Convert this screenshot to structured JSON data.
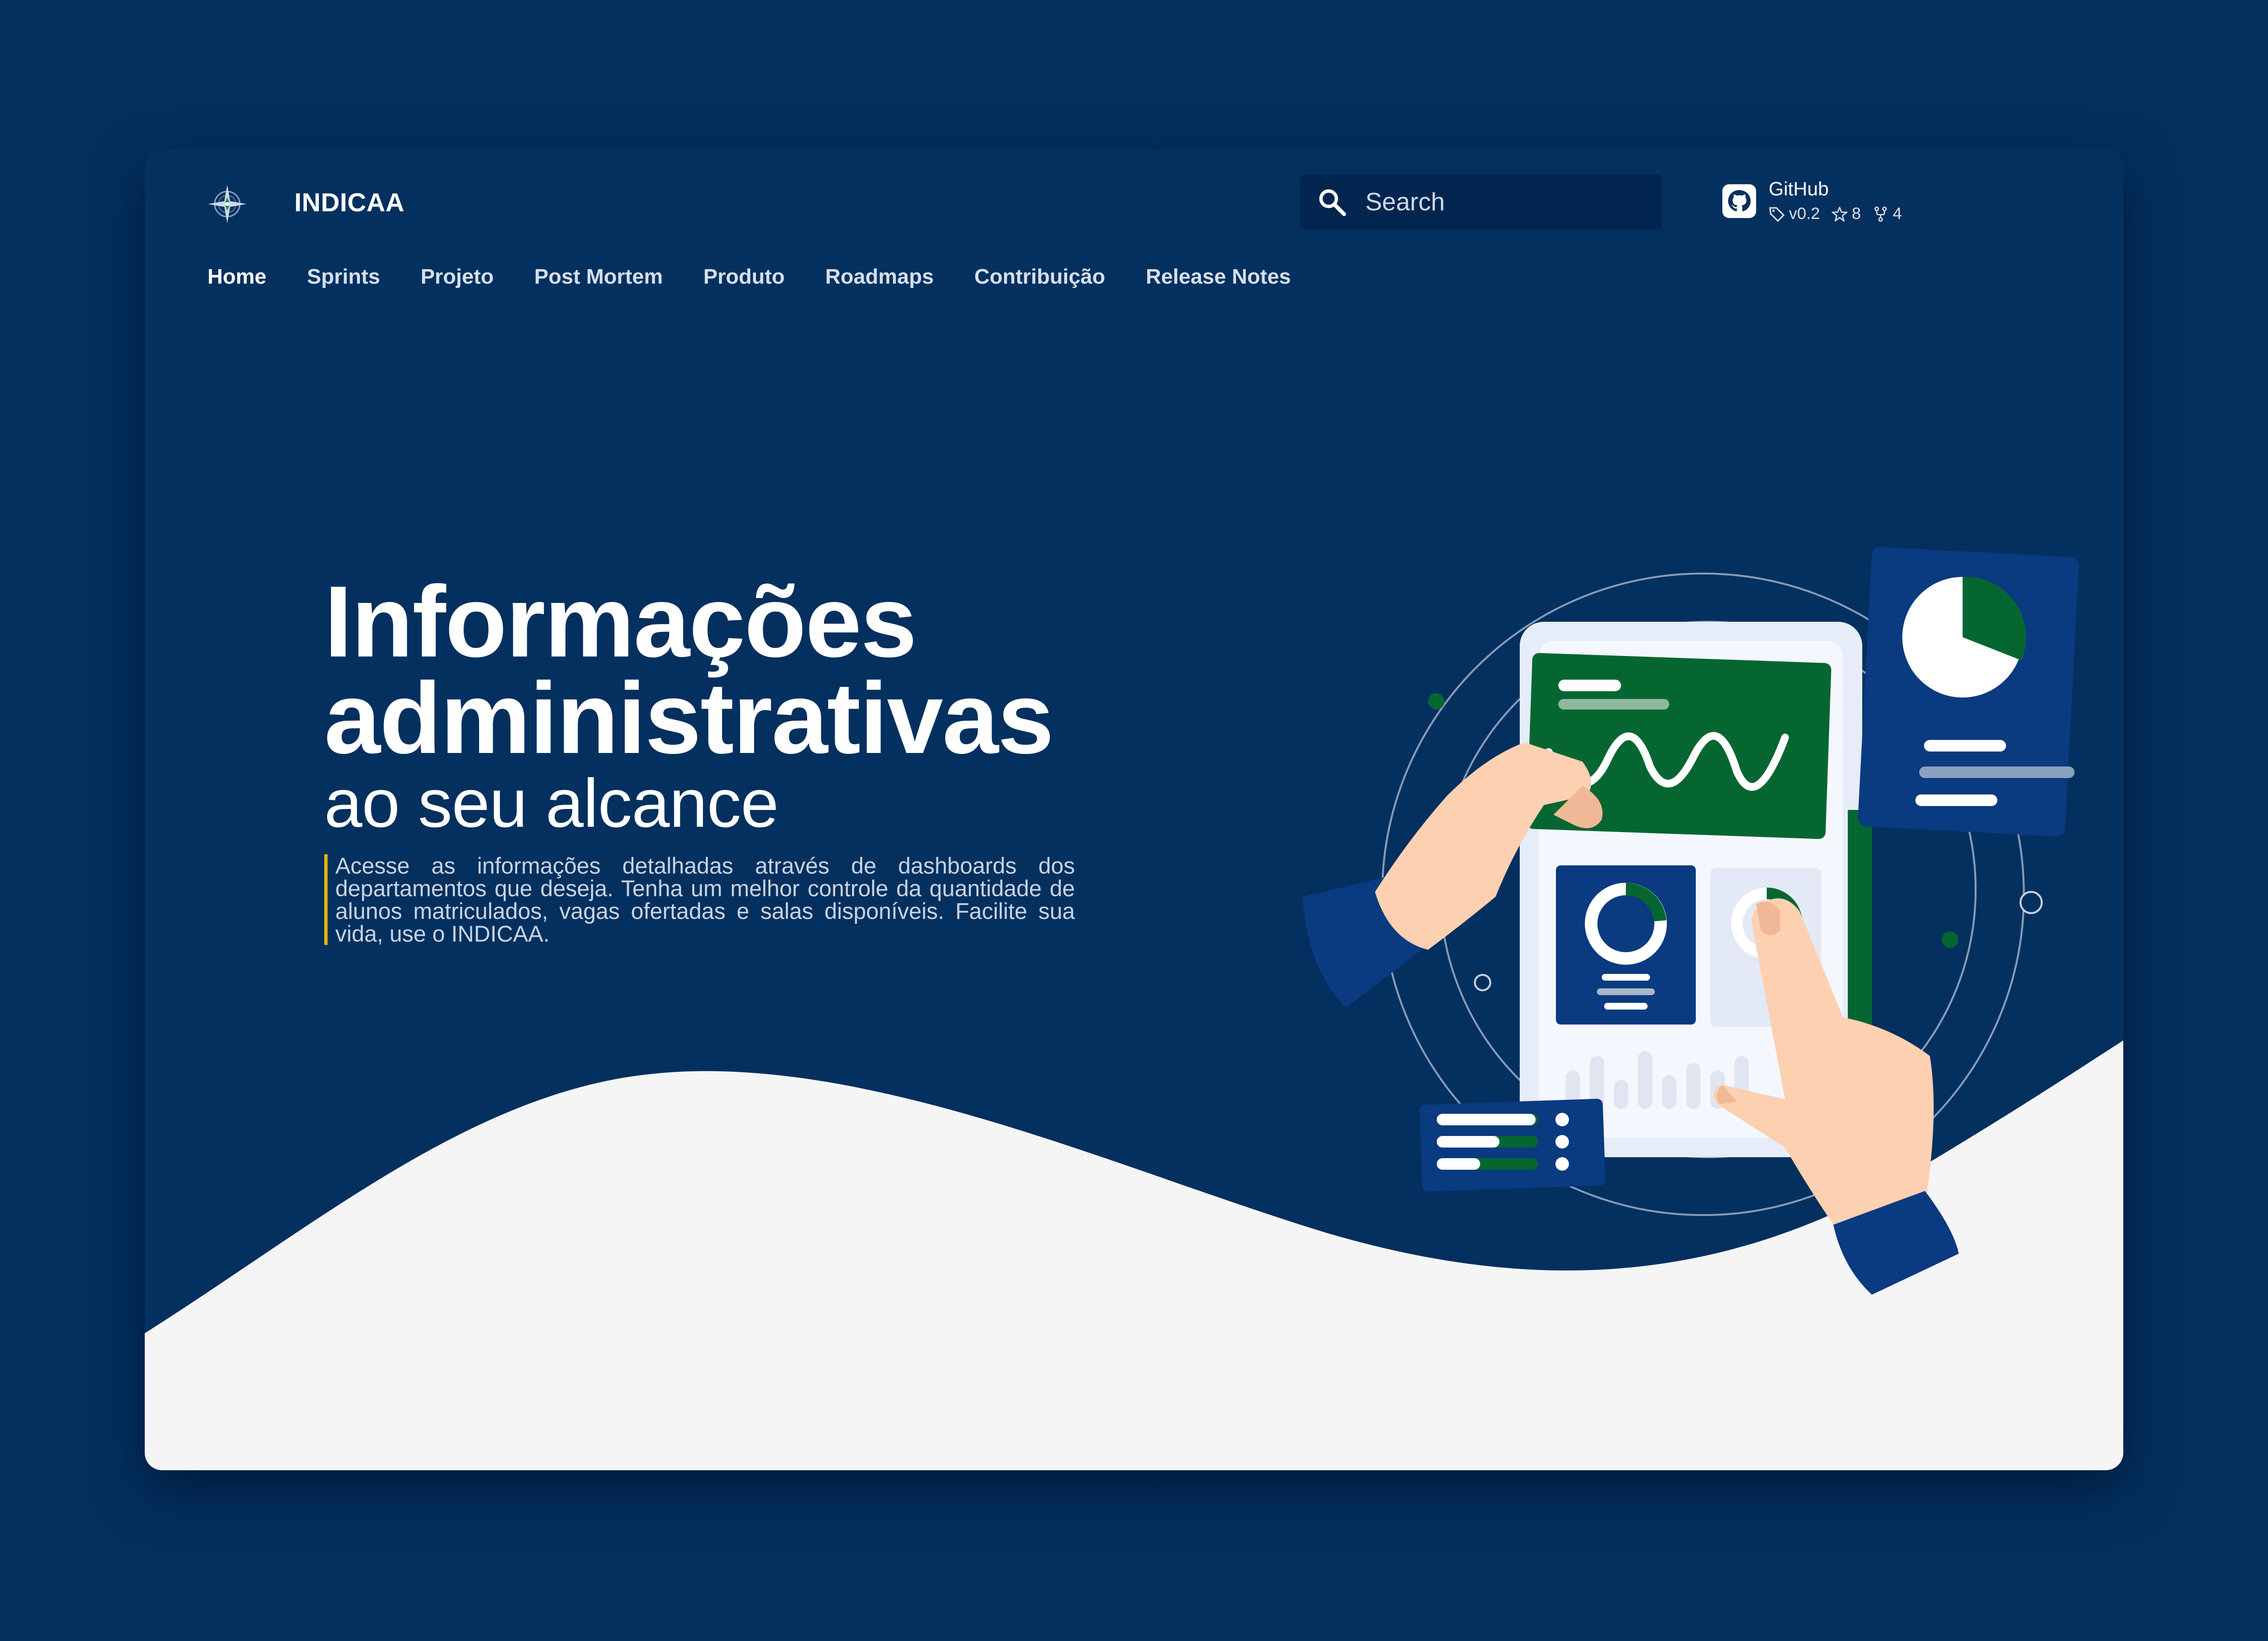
{
  "app": {
    "brand": "INDICAA",
    "logo_icon": "compass-rose-icon"
  },
  "search": {
    "placeholder": "Search",
    "icon": "search-icon"
  },
  "github": {
    "label": "GitHub",
    "icon": "github-icon",
    "version": "v0.2",
    "stars": "8",
    "forks": "4"
  },
  "nav": {
    "items": [
      {
        "label": "Home",
        "active": true
      },
      {
        "label": "Sprints",
        "active": false
      },
      {
        "label": "Projeto",
        "active": false
      },
      {
        "label": "Post Mortem",
        "active": false
      },
      {
        "label": "Produto",
        "active": false
      },
      {
        "label": "Roadmaps",
        "active": false
      },
      {
        "label": "Contribuição",
        "active": false
      },
      {
        "label": "Release Notes",
        "active": false
      }
    ]
  },
  "hero": {
    "title_line1": "Informações",
    "title_line2": "administrativas",
    "subtitle": "ao seu alcance",
    "description": "Acesse as informações detalhadas através de dashboards dos departamentos que deseja. Tenha um melhor controle da quantidade de alunos matriculados, vagas ofertadas e salas disponíveis. Facilite sua vida, use o INDICAA."
  },
  "colors": {
    "page_background": "#003066",
    "window_background": "#03305f",
    "wave": "#f5f5f6",
    "accent_green": "#066631",
    "accent_yellow": "#e3b300",
    "search_background": "#022550"
  }
}
